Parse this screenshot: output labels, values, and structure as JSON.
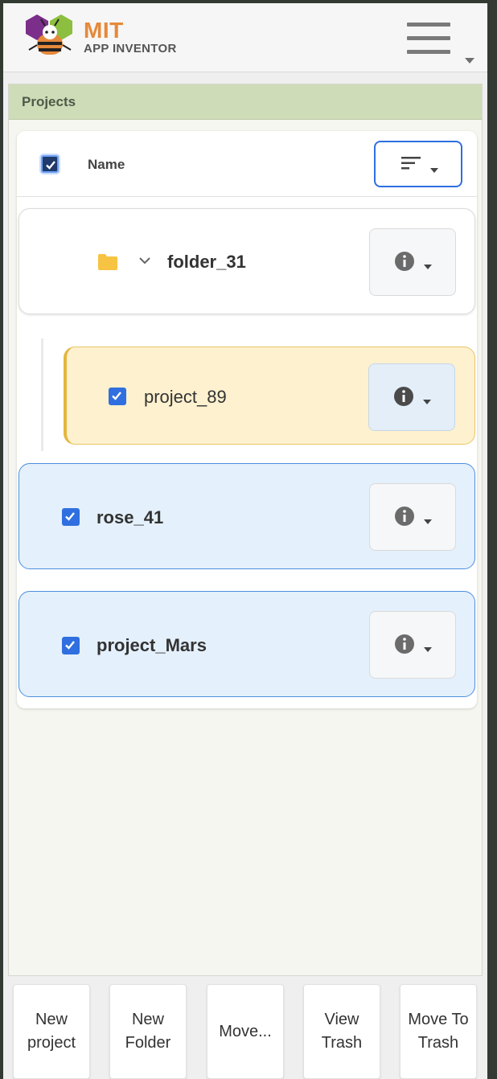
{
  "header": {
    "brand_title": "MIT",
    "brand_subtitle": "APP INVENTOR"
  },
  "projects_panel": {
    "title": "Projects",
    "name_column_label": "Name",
    "select_all_checked": true,
    "rows": [
      {
        "label": "folder_31",
        "type": "folder",
        "expanded": true,
        "checked": false
      },
      {
        "label": "project_89",
        "type": "project",
        "indented": true,
        "checked": true
      },
      {
        "label": "rose_41",
        "type": "project",
        "checked": true
      },
      {
        "label": "project_Mars",
        "type": "project",
        "checked": true
      }
    ]
  },
  "toolbar": {
    "new_project": "New\nproject",
    "new_folder": "New\nFolder",
    "move": "Move...",
    "view_trash": "View\nTrash",
    "move_to_trash": "Move To\nTrash"
  },
  "colors": {
    "accent_orange": "#e5893b",
    "panel_header": "#cfdcb8",
    "selected_row": "#e4f0fb",
    "child_row": "#fdf1cf",
    "checkbox_blue": "#2f6fe0",
    "folder_yellow": "#f7c342"
  },
  "icons": [
    "app-inventor-logo-icon",
    "hamburger-menu-icon",
    "sort-icon",
    "folder-icon",
    "chevron-down-icon",
    "info-icon",
    "dropdown-caret-icon",
    "checkbox-icon"
  ]
}
